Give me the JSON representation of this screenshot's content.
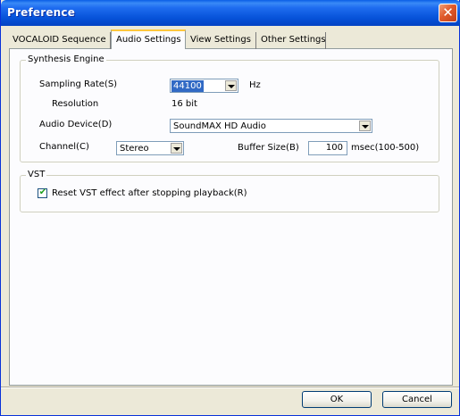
{
  "window": {
    "title": "Preference",
    "close_glyph": "✕"
  },
  "tabs": [
    {
      "label": "VOCALOID Sequence"
    },
    {
      "label": "Audio Settings"
    },
    {
      "label": "View Settings"
    },
    {
      "label": "Other Settings"
    }
  ],
  "synthesis": {
    "group_label": "Synthesis Engine",
    "sampling_rate": {
      "label": "Sampling Rate(S)",
      "value": "44100",
      "unit": "Hz"
    },
    "resolution": {
      "label": "Resolution",
      "value": "16 bit"
    },
    "audio_device": {
      "label": "Audio Device(D)",
      "value": "SoundMAX HD Audio"
    },
    "channel": {
      "label": "Channel(C)",
      "value": "Stereo"
    },
    "buffer": {
      "label": "Buffer Size(B)",
      "value": "100",
      "unit": "msec(100-500)"
    }
  },
  "vst": {
    "group_label": "VST",
    "reset_checkbox": {
      "label": "Reset VST effect after stopping playback(R)",
      "checked": true
    }
  },
  "buttons": {
    "ok": "OK",
    "cancel": "Cancel"
  },
  "colors": {
    "title_bar": "#0a5ee6",
    "window_bg": "#ece9d8",
    "selection": "#316ac5",
    "close": "#e05a2b"
  }
}
